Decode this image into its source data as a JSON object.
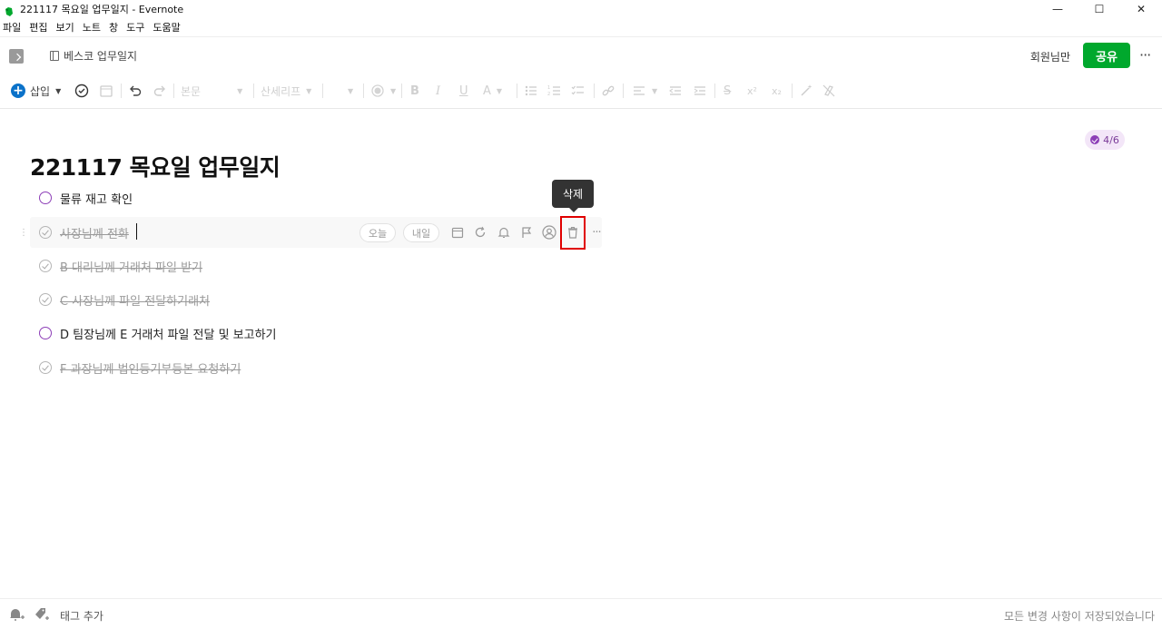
{
  "window": {
    "title": "221117 목요일 업무일지 - Evernote",
    "controls": {
      "minimize": "—",
      "maximize": "☐",
      "close": "✕"
    }
  },
  "menu": [
    "파일",
    "편집",
    "보기",
    "노트",
    "창",
    "도구",
    "도움말"
  ],
  "header": {
    "notebook": "베스코 업무일지",
    "members": "회원님만",
    "share_label": "공유",
    "more": "···"
  },
  "toolbar": {
    "insert_label": "삽입",
    "font_style": "본문",
    "font_family": "산세리프",
    "icons": [
      "plus-circle-icon",
      "task-check-icon",
      "calendar-icon",
      "undo-icon",
      "redo-icon",
      "highlight-icon",
      "bold-icon",
      "italic-icon",
      "underline-icon",
      "text-color-icon",
      "bullet-list-icon",
      "numbered-list-icon",
      "checklist-icon",
      "link-icon",
      "align-icon",
      "indent-decrease-icon",
      "indent-increase-icon",
      "strikethrough-icon",
      "superscript-icon",
      "subscript-icon",
      "ai-wand-icon",
      "clear-format-icon"
    ],
    "superscript": "x²",
    "subscript": "x₂"
  },
  "note": {
    "title": "221117 목요일 업무일지",
    "progress": "4/6",
    "tasks": [
      {
        "label": "물류 재고 확인",
        "done": false
      },
      {
        "label": "사장님께 전화",
        "done": true
      },
      {
        "label": "B 대리님께 거래처 파일 받기",
        "done": true
      },
      {
        "label": "C 사장님께 파일 전달하기래처",
        "done": true
      },
      {
        "label": "D 팀장님께 E 거래처 파일 전달 및 보고하기",
        "done": false
      },
      {
        "label": "F 과장님께 법인등기부등본 요청하기",
        "done": true
      }
    ],
    "task_actions": {
      "today": "오늘",
      "tomorrow": "내일"
    },
    "tooltip": "삭제",
    "colors": {
      "accent_purple": "#8d3fb7",
      "share_green": "#00a82d",
      "highlight_red": "#e00000"
    }
  },
  "footer": {
    "tag_add": "태그 추가",
    "status": "모든 변경 사항이 저장되었습니다"
  }
}
